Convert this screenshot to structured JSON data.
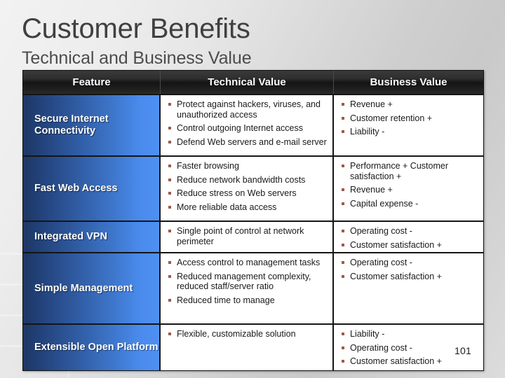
{
  "slide": {
    "title": "Customer Benefits",
    "subtitle": "Technical and Business Value",
    "page_number": "101",
    "colors": {
      "title_text": "#404040",
      "subtitle_text": "#4c4c4c",
      "header_band": "#1e1e1e",
      "feature_gradient_start": "#1c3764",
      "feature_gradient_end": "#4e90f2",
      "bullet_marker": "#9c5a4a",
      "cell_text": "#1a1a1a",
      "background": "#d9d9d9"
    }
  },
  "table": {
    "headers": {
      "feature": "Feature",
      "technical": "Technical Value",
      "business": "Business Value"
    },
    "rows": [
      {
        "feature": "Secure Internet Connectivity",
        "technical": [
          "Protect against hackers, viruses, and unauthorized access",
          "Control outgoing Internet access",
          "Defend Web servers and e-mail server"
        ],
        "business": [
          "Revenue +",
          "Customer retention +",
          "Liability -"
        ]
      },
      {
        "feature": "Fast Web Access",
        "technical": [
          "Faster browsing",
          "Reduce network bandwidth costs",
          "Reduce stress on Web servers",
          "More reliable data access"
        ],
        "business": [
          "Performance + Customer satisfaction +",
          "Revenue +",
          "Capital expense -"
        ]
      },
      {
        "feature": "Integrated VPN",
        "technical": [
          "Single point of control at network perimeter"
        ],
        "business": [
          "Operating cost -",
          "Customer satisfaction +"
        ]
      },
      {
        "feature": "Simple Management",
        "technical": [
          "Access control to management tasks",
          "Reduced management complexity, reduced staff/server ratio",
          "Reduced time to manage"
        ],
        "business": [
          "Operating cost -",
          "Customer satisfaction +"
        ]
      },
      {
        "feature": "Extensible Open Platform",
        "technical": [
          "Flexible, customizable solution"
        ],
        "business": [
          "Liability -",
          "Operating cost -",
          "Customer satisfaction +"
        ]
      }
    ]
  }
}
